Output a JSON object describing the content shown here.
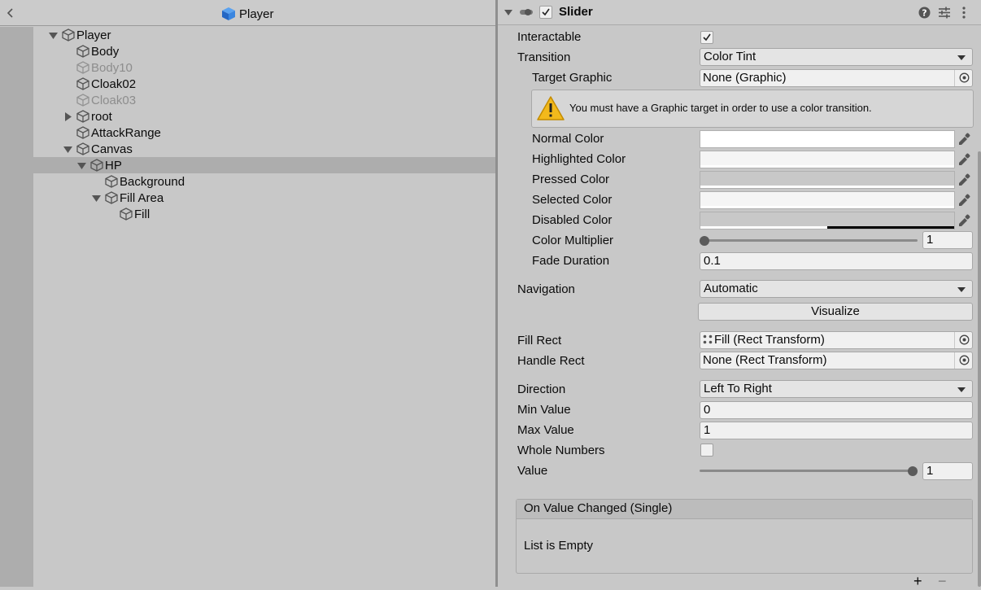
{
  "hierarchy": {
    "title": "Player",
    "items": [
      {
        "label": "Player"
      },
      {
        "label": "Body"
      },
      {
        "label": "Body10"
      },
      {
        "label": "Cloak02"
      },
      {
        "label": "Cloak03"
      },
      {
        "label": "root"
      },
      {
        "label": "AttackRange"
      },
      {
        "label": "Canvas"
      },
      {
        "label": "HP"
      },
      {
        "label": "Background"
      },
      {
        "label": "Fill Area"
      },
      {
        "label": "Fill"
      }
    ]
  },
  "inspector": {
    "component_title": "Slider",
    "enabled": true,
    "interactable_label": "Interactable",
    "interactable_checked": true,
    "transition_label": "Transition",
    "transition_value": "Color Tint",
    "target_graphic_label": "Target Graphic",
    "target_graphic_value": "None (Graphic)",
    "warning_text": "You must have a Graphic target in order to use a color transition.",
    "normal_color_label": "Normal Color",
    "highlighted_color_label": "Highlighted Color",
    "pressed_color_label": "Pressed Color",
    "selected_color_label": "Selected Color",
    "disabled_color_label": "Disabled Color",
    "colors": {
      "normal": "#FFFFFF",
      "highlighted": "#F5F5F5",
      "pressed": "#C8C8C8",
      "selected": "#F5F5F5",
      "disabled": "#C8C8C8"
    },
    "color_alphas": {
      "normal": 1.0,
      "highlighted": 1.0,
      "pressed": 1.0,
      "selected": 1.0,
      "disabled": 0.5
    },
    "color_multiplier_label": "Color Multiplier",
    "color_multiplier_value": "1",
    "color_multiplier_fraction": 0.0,
    "fade_duration_label": "Fade Duration",
    "fade_duration_value": "0.1",
    "navigation_label": "Navigation",
    "navigation_value": "Automatic",
    "visualize_label": "Visualize",
    "fill_rect_label": "Fill Rect",
    "fill_rect_value": "Fill (Rect Transform)",
    "handle_rect_label": "Handle Rect",
    "handle_rect_value": "None (Rect Transform)",
    "direction_label": "Direction",
    "direction_value": "Left To Right",
    "min_value_label": "Min Value",
    "min_value": "0",
    "max_value_label": "Max Value",
    "max_value": "1",
    "whole_numbers_label": "Whole Numbers",
    "whole_numbers_checked": false,
    "value_label": "Value",
    "value": "1",
    "value_fraction": 1.0,
    "event_title": "On Value Changed (Single)",
    "event_empty_text": "List is Empty",
    "add_symbol": "+",
    "remove_symbol": "−"
  },
  "icons": {
    "back": "chevron-left-icon",
    "prefab": "prefab-cube-icon",
    "gameobject": "gameobject-cube-icon",
    "warning": "warning-icon",
    "eyedropper": "eyedropper-icon",
    "object_picker": "object-picker-icon",
    "help": "help-icon",
    "presets": "presets-icon",
    "kebab": "kebab-menu-icon"
  },
  "accent": "#2e86de"
}
